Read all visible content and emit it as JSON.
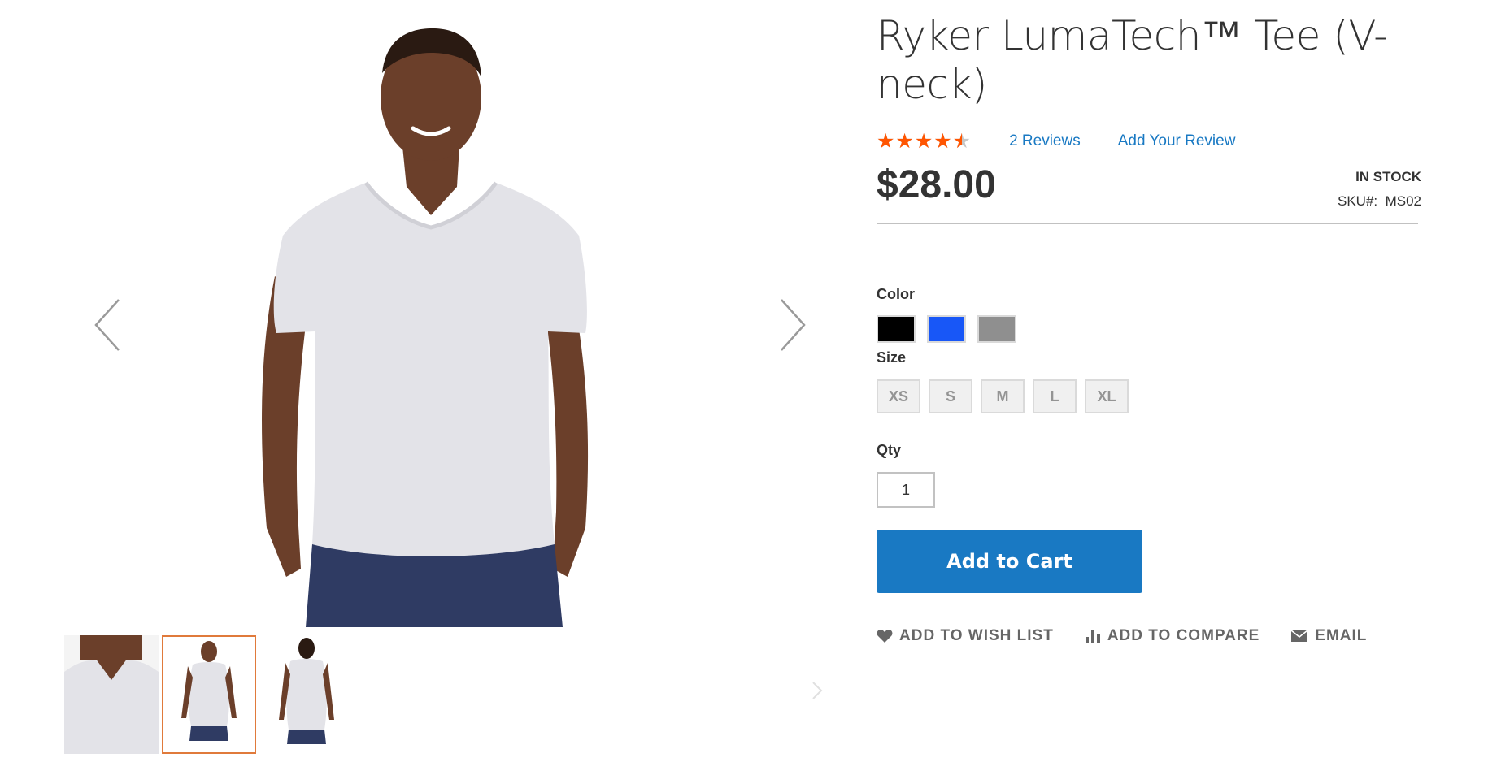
{
  "product": {
    "title": "Ryker LumaTech™ Tee (V-neck)",
    "rating_percent": 90,
    "reviews_label": "2 Reviews",
    "add_review_label": "Add Your Review",
    "price": "$28.00",
    "stock_status": "In stock",
    "sku_label": "SKU#:",
    "sku": "MS02"
  },
  "options": {
    "color_label": "Color",
    "colors": [
      {
        "name": "Black",
        "hex": "#000000"
      },
      {
        "name": "Blue",
        "hex": "#1857f7"
      },
      {
        "name": "Gray",
        "hex": "#8f8f8f"
      }
    ],
    "size_label": "Size",
    "sizes": [
      "XS",
      "S",
      "M",
      "L",
      "XL"
    ],
    "qty_label": "Qty",
    "qty_value": "1"
  },
  "actions": {
    "add_to_cart": "Add to Cart",
    "wish_list": "Add to Wish List",
    "compare": "Add to Compare",
    "email": "Email"
  },
  "gallery": {
    "thumbnail_count": 3,
    "active_thumbnail": 2
  },
  "colors": {
    "accent": "#1979c3",
    "star": "#ff5501",
    "thumb_active_border": "#e07a3b"
  }
}
